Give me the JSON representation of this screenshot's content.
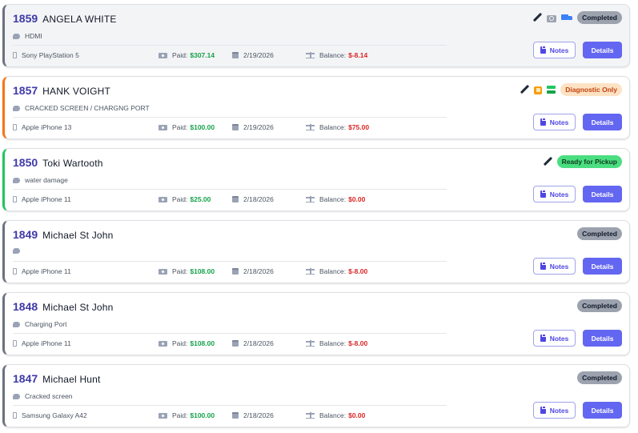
{
  "labels": {
    "paid": "Paid:",
    "balance": "Balance:",
    "notes": "Notes",
    "details": "Details"
  },
  "tickets": [
    {
      "number": "1859",
      "customer": "ANGELA WHITE",
      "issue": "HDMI",
      "device": "Sony PlayStation 5",
      "paid": "$307.14",
      "date": "2/19/2026",
      "balance": "$-8.14",
      "status": "Completed",
      "status_style": "completed",
      "accent_color": "#6b7280",
      "shaded": true,
      "icons": [
        "pencil-icon",
        "camera-icon",
        "truck-icon"
      ]
    },
    {
      "number": "1857",
      "customer": "HANK VOIGHT",
      "issue": "CRACKED SCREEN / CHARGNG PORT",
      "device": "Apple iPhone 13",
      "paid": "$100.00",
      "date": "2/19/2026",
      "balance": "$75.00",
      "status": "Diagnostic Only",
      "status_style": "diagnostic",
      "accent_color": "#f97316",
      "shaded": false,
      "icons": [
        "pencil-icon",
        "chip-icon",
        "stack-icon"
      ]
    },
    {
      "number": "1850",
      "customer": "Toki Wartooth",
      "issue": "water damage",
      "device": "Apple iPhone 11",
      "paid": "$25.00",
      "date": "2/18/2026",
      "balance": "$0.00",
      "status": "Ready for Pickup",
      "status_style": "ready",
      "accent_color": "#22c55e",
      "shaded": false,
      "icons": [
        "pencil-icon"
      ]
    },
    {
      "number": "1849",
      "customer": "Michael St John",
      "issue": "",
      "device": "Apple iPhone 11",
      "paid": "$108.00",
      "date": "2/18/2026",
      "balance": "$-8.00",
      "status": "Completed",
      "status_style": "completed",
      "accent_color": "#6b7280",
      "shaded": false,
      "icons": []
    },
    {
      "number": "1848",
      "customer": "Michael St John",
      "issue": "Charging Port",
      "device": "Apple iPhone 11",
      "paid": "$108.00",
      "date": "2/18/2026",
      "balance": "$-8.00",
      "status": "Completed",
      "status_style": "completed",
      "accent_color": "#6b7280",
      "shaded": false,
      "icons": []
    },
    {
      "number": "1847",
      "customer": "Michael Hunt",
      "issue": "Cracked screen",
      "device": "Samsung Galaxy A42",
      "paid": "$100.00",
      "date": "2/18/2026",
      "balance": "$0.00",
      "status": "Completed",
      "status_style": "completed",
      "accent_color": "#6b7280",
      "shaded": false,
      "icons": []
    }
  ]
}
